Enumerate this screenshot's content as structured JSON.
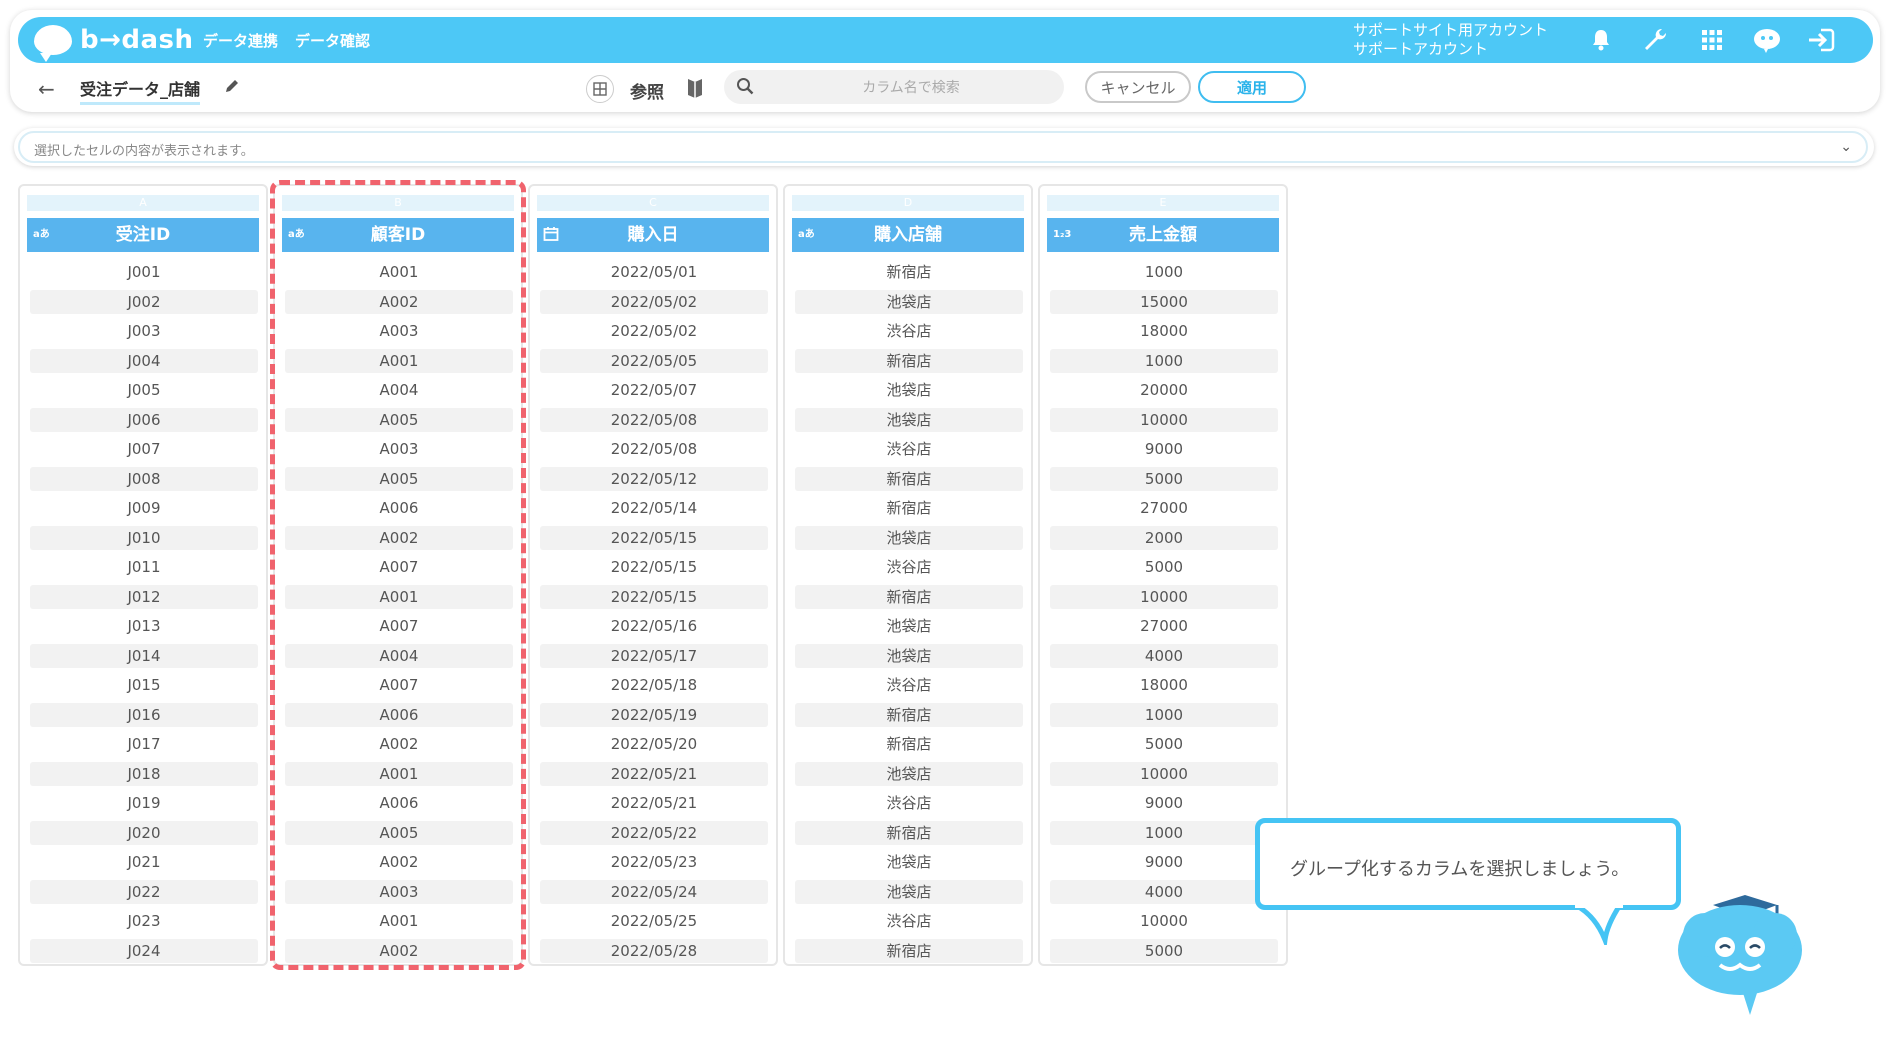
{
  "app": {
    "logo_text": "b→dash"
  },
  "nav": {
    "items": [
      "データ連携",
      "データ確認"
    ]
  },
  "account": {
    "line1": "サポートサイト用アカウント",
    "line2": "サポートアカウント"
  },
  "toolbar": {
    "table_name": "受注データ_店舗",
    "ref_label": "参照",
    "search_placeholder": "カラム名で検索",
    "cancel_label": "キャンセル",
    "apply_label": "適用"
  },
  "cell_viewer": {
    "placeholder": "選択したセルの内容が表示されます。"
  },
  "columns": [
    {
      "letter": "A",
      "name": "受注ID",
      "type": "text",
      "type_label": "aあ",
      "values": [
        "J001",
        "J002",
        "J003",
        "J004",
        "J005",
        "J006",
        "J007",
        "J008",
        "J009",
        "J010",
        "J011",
        "J012",
        "J013",
        "J014",
        "J015",
        "J016",
        "J017",
        "J018",
        "J019",
        "J020",
        "J021",
        "J022",
        "J023",
        "J024"
      ]
    },
    {
      "letter": "B",
      "name": "顧客ID",
      "type": "text",
      "type_label": "aあ",
      "values": [
        "A001",
        "A002",
        "A003",
        "A001",
        "A004",
        "A005",
        "A003",
        "A005",
        "A006",
        "A002",
        "A007",
        "A001",
        "A007",
        "A004",
        "A007",
        "A006",
        "A002",
        "A001",
        "A006",
        "A005",
        "A002",
        "A003",
        "A001",
        "A002"
      ]
    },
    {
      "letter": "C",
      "name": "購入日",
      "type": "date",
      "type_label": "",
      "values": [
        "2022/05/01",
        "2022/05/02",
        "2022/05/02",
        "2022/05/05",
        "2022/05/07",
        "2022/05/08",
        "2022/05/08",
        "2022/05/12",
        "2022/05/14",
        "2022/05/15",
        "2022/05/15",
        "2022/05/15",
        "2022/05/16",
        "2022/05/17",
        "2022/05/18",
        "2022/05/19",
        "2022/05/20",
        "2022/05/21",
        "2022/05/21",
        "2022/05/22",
        "2022/05/23",
        "2022/05/24",
        "2022/05/25",
        "2022/05/28"
      ]
    },
    {
      "letter": "D",
      "name": "購入店舗",
      "type": "text",
      "type_label": "aあ",
      "values": [
        "新宿店",
        "池袋店",
        "渋谷店",
        "新宿店",
        "池袋店",
        "池袋店",
        "渋谷店",
        "新宿店",
        "新宿店",
        "池袋店",
        "渋谷店",
        "新宿店",
        "池袋店",
        "池袋店",
        "渋谷店",
        "新宿店",
        "新宿店",
        "池袋店",
        "渋谷店",
        "新宿店",
        "池袋店",
        "池袋店",
        "渋谷店",
        "新宿店"
      ]
    },
    {
      "letter": "E",
      "name": "売上金額",
      "type": "number",
      "type_label": "1₂3",
      "values": [
        "1000",
        "15000",
        "18000",
        "1000",
        "20000",
        "10000",
        "9000",
        "5000",
        "27000",
        "2000",
        "5000",
        "10000",
        "27000",
        "4000",
        "18000",
        "1000",
        "5000",
        "10000",
        "9000",
        "1000",
        "9000",
        "4000",
        "10000",
        "5000"
      ]
    }
  ],
  "highlighted_column": "B",
  "tooltip": {
    "text": "グループ化するカラムを選択しましょう。"
  },
  "colors": {
    "header_bg": "#4dc8f6",
    "column_header": "#58b4ee",
    "highlight": "#f0636d"
  }
}
